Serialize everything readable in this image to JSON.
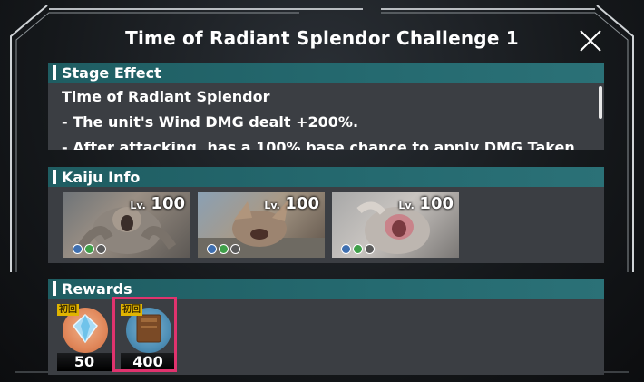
{
  "title": "Time of Radiant Splendor Challenge 1",
  "stage_effect": {
    "heading": "Stage Effect",
    "lines": [
      "Time of Radiant Splendor",
      "- The unit's Wind DMG dealt +200%.",
      "- After attacking, has a 100% base chance to apply DMG Taken"
    ]
  },
  "kaiju_info": {
    "heading": "Kaiju Info",
    "level_label": "Lv.",
    "kaiju": [
      {
        "level": "100"
      },
      {
        "level": "100"
      },
      {
        "level": "100"
      }
    ]
  },
  "rewards": {
    "heading": "Rewards",
    "items": [
      {
        "tag": "初回",
        "count": "50",
        "icon": "crystal-icon"
      },
      {
        "tag": "初回",
        "count": "400",
        "icon": "book-icon"
      }
    ]
  },
  "colors": {
    "header_teal": "#256a70",
    "panel": "#3b3e43",
    "highlight": "#e0336e",
    "first_clear_tag": "#e0b400"
  }
}
